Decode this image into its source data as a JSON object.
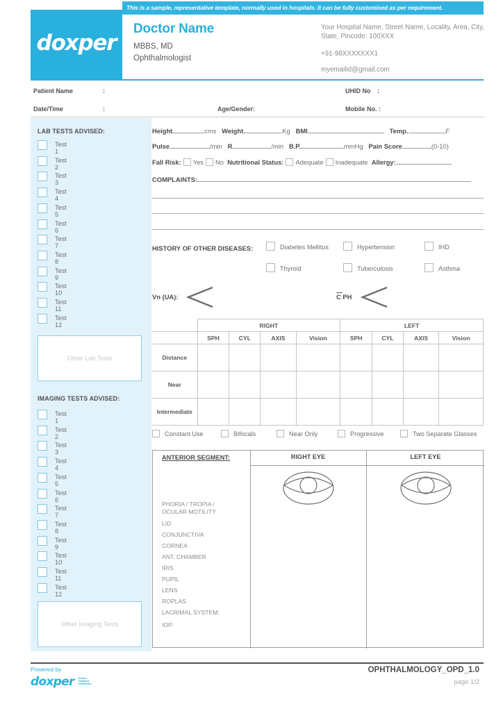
{
  "banner": {
    "text": "This is a sample, representative template, normally used in hospitals. It can be fully customised as per requirement."
  },
  "brand": {
    "logo_text": "doxper",
    "tagline_line1": "Instant",
    "tagline_line2": "Digitised",
    "tagline_line3": "Healthcare",
    "accent_color": "#2ab0dd",
    "banner_color": "#33b4e0",
    "sidebar_color": "#e2f2fa"
  },
  "doctor": {
    "name": "Doctor Name",
    "qualification": "MBBS, MD",
    "specialty": "Ophthalmologist"
  },
  "hospital": {
    "address": "Your Hospital Name, Street Name, Locality, Area, City, State, Pincode: 100XXX",
    "phone": "+91-98XXXXXXX1",
    "email": "myemailid@gmail.com"
  },
  "patient_info": {
    "patient_name_label": "Patient Name",
    "patient_name_colon": ":",
    "uhid_label": "UHID No",
    "uhid_colon": ":",
    "datetime_label": "Date/Time",
    "datetime_colon": ":",
    "age_gender_label": "Age/Gender:",
    "mobile_label": "Mobile No. :"
  },
  "sidebar": {
    "lab_heading": "LAB TESTS ADVISED:",
    "lab_tests": [
      "Test 1",
      "Test 2",
      "Test 3",
      "Test 4",
      "Test 5",
      "Test 6",
      "Test 7",
      "Test 8",
      "Test 9",
      "Test 10",
      "Test 11",
      "Test 12"
    ],
    "other_lab_placeholder": "Other Lab Tests",
    "imaging_heading": "IMAGING TESTS ADVISED:",
    "imaging_tests": [
      "Test 1",
      "Test 2",
      "Test 3",
      "Test 4",
      "Test 5",
      "Test 6",
      "Test 7",
      "Test 8",
      "Test 9",
      "Test 10",
      "Test 11",
      "Test 12"
    ],
    "other_imaging_placeholder": "Other Imaging Tests"
  },
  "vitals": {
    "height_label": "Height",
    "height_unit": "cms",
    "weight_label": "Weight",
    "weight_unit": "Kg",
    "bmi_label": "BMI",
    "temp_label": "Temp.",
    "temp_unit": "F",
    "pulse_label": "Pulse",
    "pulse_unit": "/min",
    "r_label": "R",
    "r_unit": "/min",
    "bp_label": "B.P.",
    "bp_unit": "mmHg",
    "pain_label": "Pain Score",
    "pain_unit": "(0-10)",
    "fall_risk_label": "Fall Risk:",
    "fall_yes": "Yes",
    "fall_no": "No",
    "nutritional_label": "Nutritional Status:",
    "nutritional_adequate": "Adequate",
    "nutritional_inadequate": "Inadequate",
    "allergy_label": "Allergy:",
    "complaints_label": "COMPLAINTS:"
  },
  "history": {
    "heading": "HISTORY OF OTHER DISEASES:",
    "row1": [
      "Diabetes Mellitus",
      "Hypertension",
      "IHD"
    ],
    "row2": [
      "Thyroid",
      "Tuberculosis",
      "Asthma"
    ]
  },
  "vision": {
    "vn_ua_label": "Vn (UA):",
    "c_ph_label": "C PH",
    "c_ph_bar": "̄"
  },
  "refraction": {
    "eye_headers": [
      "RIGHT",
      "LEFT"
    ],
    "columns": [
      "SPH",
      "CYL",
      "AXIS",
      "Vision",
      "SPH",
      "CYL",
      "AXIS",
      "Vision"
    ],
    "rows": [
      "Distance",
      "Near",
      "Intermediate"
    ]
  },
  "glasses_options": [
    "Constant Use",
    "Bifocals",
    "Near Only",
    "Progressive",
    "Two Separate Glasses"
  ],
  "anterior_segment": {
    "title": "ANTERIOR SEGMENT:",
    "right_eye_header": "RIGHT EYE",
    "left_eye_header": "LEFT EYE",
    "items": [
      "PHORIA / TROPIA /\nOCULAR MOTILITY",
      "LID",
      "CONJUNCTIVA",
      "CORNEA",
      "ANT. CHAMBER",
      "IRIS",
      "PUPIL",
      "LENS",
      "ROPLAS",
      "LACRIMAL SYSTEM:",
      "IOP:"
    ]
  },
  "footer": {
    "powered_by": "Powered by",
    "form_id": "OPHTHALMOLOGY_OPD_1.0",
    "page": "page 1/2"
  }
}
